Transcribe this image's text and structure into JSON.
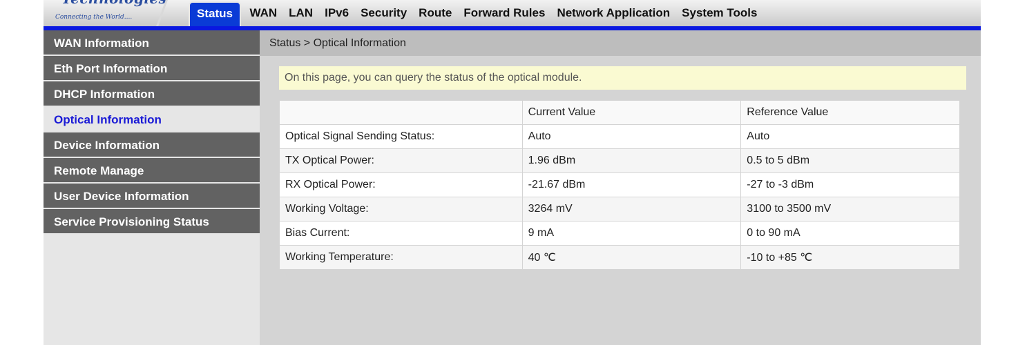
{
  "header": {
    "logo_top": "Technologies",
    "logo_tagline": "Connecting the World....",
    "tabs": [
      {
        "label": "Status",
        "active": true
      },
      {
        "label": "WAN"
      },
      {
        "label": "LAN"
      },
      {
        "label": "IPv6"
      },
      {
        "label": "Security"
      },
      {
        "label": "Route"
      },
      {
        "label": "Forward Rules"
      },
      {
        "label": "Network Application"
      },
      {
        "label": "System Tools"
      }
    ]
  },
  "sidebar": {
    "items": [
      {
        "label": "WAN Information"
      },
      {
        "label": "Eth Port Information"
      },
      {
        "label": "DHCP Information"
      },
      {
        "label": "Optical Information",
        "active": true
      },
      {
        "label": "Device Information"
      },
      {
        "label": "Remote Manage"
      },
      {
        "label": "User Device Information"
      },
      {
        "label": "Service Provisioning Status"
      }
    ]
  },
  "main": {
    "breadcrumb": "Status > Optical Information",
    "notice": "On this page, you can query the status of the optical module.",
    "table": {
      "headers": [
        "",
        "Current Value",
        "Reference Value"
      ],
      "rows": [
        [
          "Optical Signal Sending Status:",
          "Auto",
          "Auto"
        ],
        [
          "TX Optical Power:",
          "1.96 dBm",
          "0.5 to 5 dBm"
        ],
        [
          "RX Optical Power:",
          "-21.67 dBm",
          "-27 to -3 dBm"
        ],
        [
          "Working Voltage:",
          "3264 mV",
          "3100 to 3500 mV"
        ],
        [
          "Bias Current:",
          "9 mA",
          "0 to 90 mA"
        ],
        [
          "Working Temperature:",
          "40 ℃",
          "-10 to +85 ℃"
        ]
      ]
    }
  },
  "colors": {
    "accent_blue": "#0a18e0",
    "active_tab": "#0a3bd6",
    "sidebar_item": "#626262",
    "notice_bg": "#fafad2"
  }
}
